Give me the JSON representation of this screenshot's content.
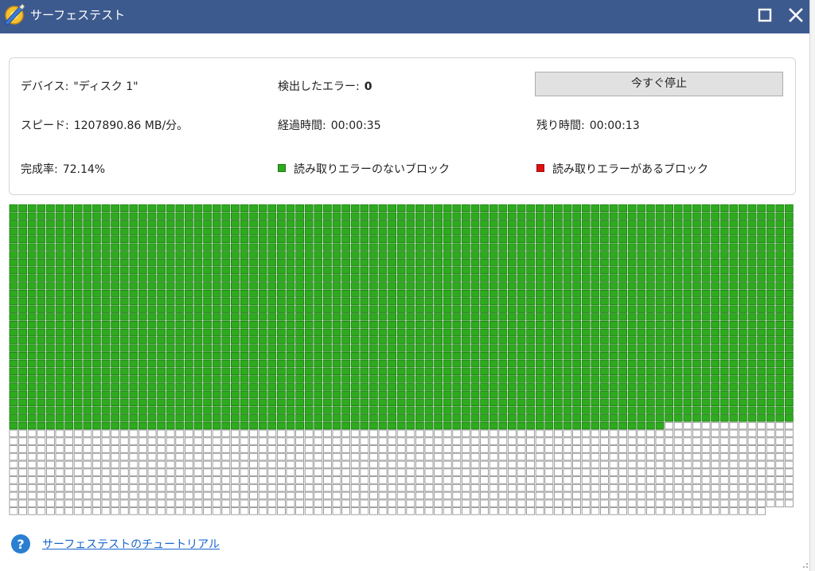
{
  "window": {
    "title": "サーフェステスト",
    "icon": "surface-test-app-icon",
    "controls": [
      "maximize-icon",
      "close-icon"
    ],
    "titlebar_color": "#3d5a8e"
  },
  "info": {
    "device_label": "デバイス:",
    "device_value": "\"ディスク 1\"",
    "errors_label": "検出したエラー:",
    "errors_value": "0",
    "speed_label": "スピード:",
    "speed_value": "1207890.86 MB/分。",
    "elapsed_label": "経過時間:",
    "elapsed_value": "00:00:35",
    "remaining_label": "残り時間:",
    "remaining_value": "00:00:13",
    "completion_label": "完成率:",
    "completion_value": "72.14%",
    "stop_button": "今すぐ停止"
  },
  "legend": {
    "ok_label": "読み取りエラーのないブロック",
    "ok_color": "#2eaa1e",
    "bad_label": "読み取りエラーがあるブロック",
    "bad_color": "#dd1111"
  },
  "block_map": {
    "columns": 85,
    "rows": 40,
    "total_blocks": 3397,
    "scanned_blocks": 2451,
    "error_blocks": 0,
    "scanned_color": "#2eaa1e",
    "unscanned_color": "#ffffff"
  },
  "help": {
    "icon": "help-question-icon",
    "link_text": "サーフェステストのチュートリアル"
  }
}
